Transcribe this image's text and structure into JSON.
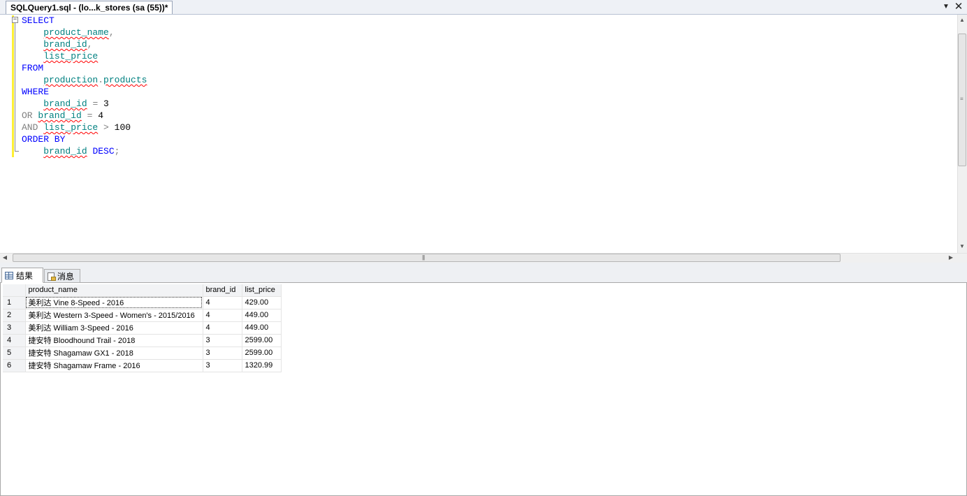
{
  "document_tab": {
    "title": "SQLQuery1.sql - (lo...k_stores (sa (55))*"
  },
  "editor": {
    "lines": [
      [
        {
          "t": "SELECT",
          "c": "kw"
        }
      ],
      [
        {
          "t": "    ",
          "c": "bk"
        },
        {
          "t": "product_name",
          "c": "id"
        },
        {
          "t": ",",
          "c": "gy"
        }
      ],
      [
        {
          "t": "    ",
          "c": "bk"
        },
        {
          "t": "brand_id",
          "c": "id"
        },
        {
          "t": ",",
          "c": "gy"
        }
      ],
      [
        {
          "t": "    ",
          "c": "bk"
        },
        {
          "t": "list_price",
          "c": "id"
        }
      ],
      [
        {
          "t": "FROM",
          "c": "kw"
        }
      ],
      [
        {
          "t": "    ",
          "c": "bk"
        },
        {
          "t": "production",
          "c": "id"
        },
        {
          "t": ".",
          "c": "gy"
        },
        {
          "t": "products",
          "c": "id"
        }
      ],
      [
        {
          "t": "WHERE",
          "c": "kw"
        }
      ],
      [
        {
          "t": "    ",
          "c": "bk"
        },
        {
          "t": "brand_id",
          "c": "id"
        },
        {
          "t": " = ",
          "c": "gy"
        },
        {
          "t": "3",
          "c": "bk"
        }
      ],
      [
        {
          "t": "OR ",
          "c": "gy"
        },
        {
          "t": "brand_id",
          "c": "id"
        },
        {
          "t": " = ",
          "c": "gy"
        },
        {
          "t": "4",
          "c": "bk"
        }
      ],
      [
        {
          "t": "AND ",
          "c": "gy"
        },
        {
          "t": "list_price",
          "c": "id"
        },
        {
          "t": " > ",
          "c": "gy"
        },
        {
          "t": "100",
          "c": "bk"
        }
      ],
      [
        {
          "t": "ORDER BY",
          "c": "kw"
        }
      ],
      [
        {
          "t": "    ",
          "c": "bk"
        },
        {
          "t": "brand_id",
          "c": "id"
        },
        {
          "t": " ",
          "c": "bk"
        },
        {
          "t": "DESC",
          "c": "kw"
        },
        {
          "t": ";",
          "c": "gy"
        }
      ]
    ]
  },
  "results_tabs": {
    "results": "结果",
    "messages": "消息"
  },
  "grid": {
    "columns": [
      "product_name",
      "brand_id",
      "list_price"
    ],
    "rows": [
      {
        "n": "1",
        "product_name": "美利达 Vine 8-Speed - 2016",
        "brand_id": "4",
        "list_price": "429.00"
      },
      {
        "n": "2",
        "product_name": "美利达 Western 3-Speed - Women's - 2015/2016",
        "brand_id": "4",
        "list_price": "449.00"
      },
      {
        "n": "3",
        "product_name": "美利达 William 3-Speed - 2016",
        "brand_id": "4",
        "list_price": "449.00"
      },
      {
        "n": "4",
        "product_name": "捷安特 Bloodhound Trail - 2018",
        "brand_id": "3",
        "list_price": "2599.00"
      },
      {
        "n": "5",
        "product_name": "捷安特 Shagamaw GX1 - 2018",
        "brand_id": "3",
        "list_price": "2599.00"
      },
      {
        "n": "6",
        "product_name": "捷安特 Shagamaw Frame - 2016",
        "brand_id": "3",
        "list_price": "1320.99"
      }
    ]
  },
  "icons": {
    "tab_dropdown": "chevron-down-icon",
    "tab_close": "close-icon",
    "results_tab": "grid-icon",
    "messages_tab": "message-icon",
    "editor_fold": "collapse-icon"
  }
}
